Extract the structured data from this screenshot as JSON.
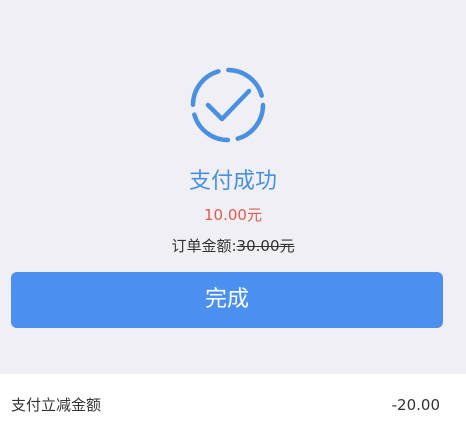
{
  "result": {
    "icon": "check-circle-icon",
    "accent_color": "#4a90e2",
    "title": "支付成功",
    "paid_amount": "10.00元",
    "order_amount_label": "订单金额:",
    "order_original_amount": "30.00元",
    "done_button_label": "完成"
  },
  "details": {
    "discount_label": "支付立减金额",
    "discount_value": "-20.00"
  }
}
